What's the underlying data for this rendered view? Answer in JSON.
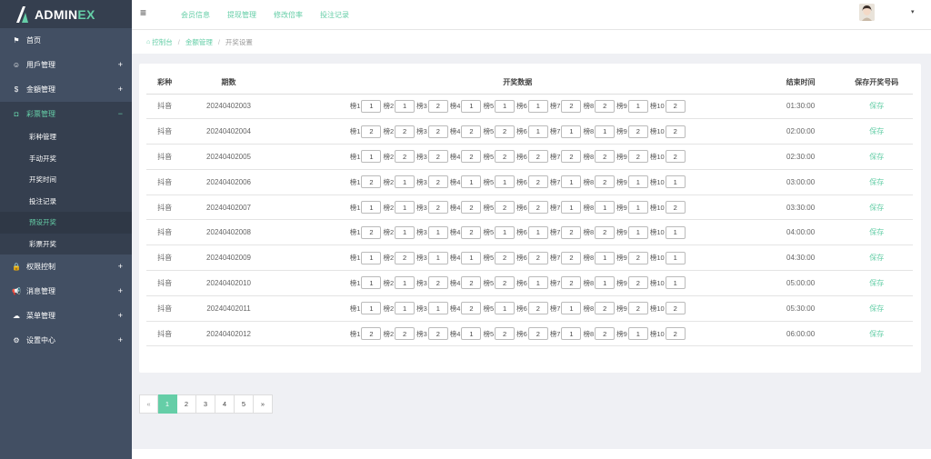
{
  "brand": {
    "name": "ADMIN",
    "suffix": "EX"
  },
  "sidebar": {
    "items": [
      {
        "icon": "flag-icon",
        "glyph": "⚑",
        "label": "首页",
        "expandable": false
      },
      {
        "icon": "smile-icon",
        "glyph": "☺",
        "label": "用戶管理",
        "expandable": true
      },
      {
        "icon": "dollar-icon",
        "glyph": "$",
        "label": "金額管理",
        "expandable": true
      },
      {
        "icon": "magnet-icon",
        "glyph": "◘",
        "label": "彩票管理",
        "expandable": true,
        "active": true
      },
      {
        "icon": "lock-icon",
        "glyph": "🔒",
        "label": "权限控制",
        "expandable": true
      },
      {
        "icon": "bullhorn-icon",
        "glyph": "📢",
        "label": "消息管理",
        "expandable": true
      },
      {
        "icon": "cloud-icon",
        "glyph": "☁",
        "label": "菜单管理",
        "expandable": true
      },
      {
        "icon": "gear-icon",
        "glyph": "⚙",
        "label": "设置中心",
        "expandable": true
      }
    ],
    "sub_items": [
      "彩种管理",
      "手动开奖",
      "开奖时间",
      "投注记录",
      "预设开奖",
      "彩票开奖"
    ],
    "expand_open": "−",
    "expand_closed": "+"
  },
  "header": {
    "menu_glyph": "≡",
    "nav": [
      "会员信息",
      "提现管理",
      "修改倍率",
      "投注记录"
    ],
    "caret": "▾"
  },
  "breadcrumb": {
    "home_glyph": "⌂",
    "items": [
      "控制台",
      "金额管理",
      "开奖设置"
    ]
  },
  "table": {
    "headers": [
      "彩种",
      "期数",
      "开奖数据",
      "结束时间",
      "保存开奖号码"
    ],
    "slot_labels": [
      "榜1",
      "榜2",
      "榜3",
      "榜4",
      "榜5",
      "榜6",
      "榜7",
      "榜8",
      "榜9",
      "榜10"
    ],
    "save_label": "保存",
    "rows": [
      {
        "kind": "抖音",
        "issue": "20240402003",
        "values": [
          "1",
          "1",
          "2",
          "1",
          "1",
          "1",
          "2",
          "2",
          "1",
          "2"
        ],
        "end": "01:30:00"
      },
      {
        "kind": "抖音",
        "issue": "20240402004",
        "values": [
          "2",
          "2",
          "2",
          "2",
          "2",
          "1",
          "1",
          "1",
          "2",
          "2"
        ],
        "end": "02:00:00"
      },
      {
        "kind": "抖音",
        "issue": "20240402005",
        "values": [
          "1",
          "2",
          "2",
          "2",
          "2",
          "2",
          "2",
          "2",
          "2",
          "2"
        ],
        "end": "02:30:00"
      },
      {
        "kind": "抖音",
        "issue": "20240402006",
        "values": [
          "2",
          "1",
          "2",
          "1",
          "1",
          "2",
          "1",
          "2",
          "1",
          "1"
        ],
        "end": "03:00:00"
      },
      {
        "kind": "抖音",
        "issue": "20240402007",
        "values": [
          "1",
          "1",
          "2",
          "2",
          "2",
          "2",
          "1",
          "1",
          "1",
          "2"
        ],
        "end": "03:30:00"
      },
      {
        "kind": "抖音",
        "issue": "20240402008",
        "values": [
          "2",
          "1",
          "1",
          "2",
          "1",
          "1",
          "2",
          "2",
          "1",
          "1"
        ],
        "end": "04:00:00"
      },
      {
        "kind": "抖音",
        "issue": "20240402009",
        "values": [
          "1",
          "2",
          "1",
          "1",
          "2",
          "2",
          "2",
          "1",
          "2",
          "1"
        ],
        "end": "04:30:00"
      },
      {
        "kind": "抖音",
        "issue": "20240402010",
        "values": [
          "1",
          "1",
          "2",
          "2",
          "2",
          "1",
          "2",
          "1",
          "2",
          "1"
        ],
        "end": "05:00:00"
      },
      {
        "kind": "抖音",
        "issue": "20240402011",
        "values": [
          "1",
          "1",
          "1",
          "2",
          "1",
          "2",
          "1",
          "2",
          "2",
          "2"
        ],
        "end": "05:30:00"
      },
      {
        "kind": "抖音",
        "issue": "20240402012",
        "values": [
          "2",
          "2",
          "2",
          "1",
          "2",
          "2",
          "1",
          "2",
          "1",
          "2"
        ],
        "end": "06:00:00"
      }
    ]
  },
  "pagination": {
    "prev": "«",
    "pages": [
      "1",
      "2",
      "3",
      "4",
      "5"
    ],
    "current": "1",
    "next": "»"
  },
  "colors": {
    "accent": "#65cea7",
    "sidebar": "#424f63",
    "sidebar_dark": "#353f4f"
  }
}
